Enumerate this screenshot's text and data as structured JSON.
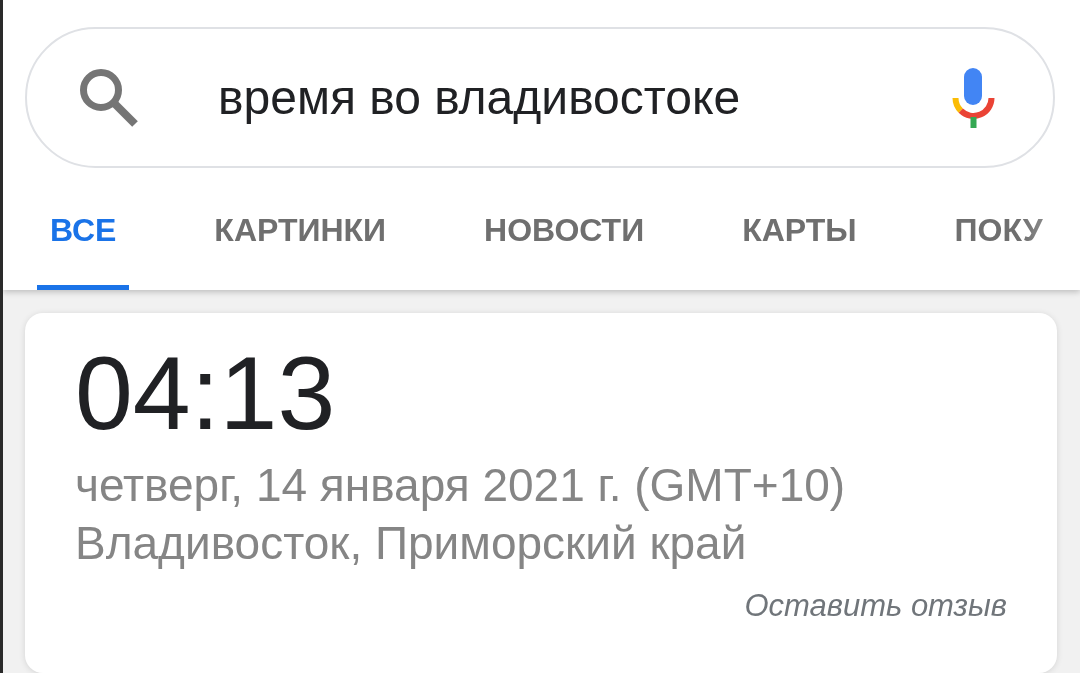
{
  "search": {
    "query": "время во владивостоке"
  },
  "tabs": [
    {
      "label": "ВСЕ",
      "selected": true
    },
    {
      "label": "КАРТИНКИ",
      "selected": false
    },
    {
      "label": "НОВОСТИ",
      "selected": false
    },
    {
      "label": "КАРТЫ",
      "selected": false
    },
    {
      "label": "ПОКУ",
      "selected": false
    }
  ],
  "time_card": {
    "time": "04:13",
    "date": "четверг, 14 января 2021 г. (GMT+10)",
    "location": "Владивосток, Приморский край",
    "feedback_link": "Оставить отзыв"
  }
}
